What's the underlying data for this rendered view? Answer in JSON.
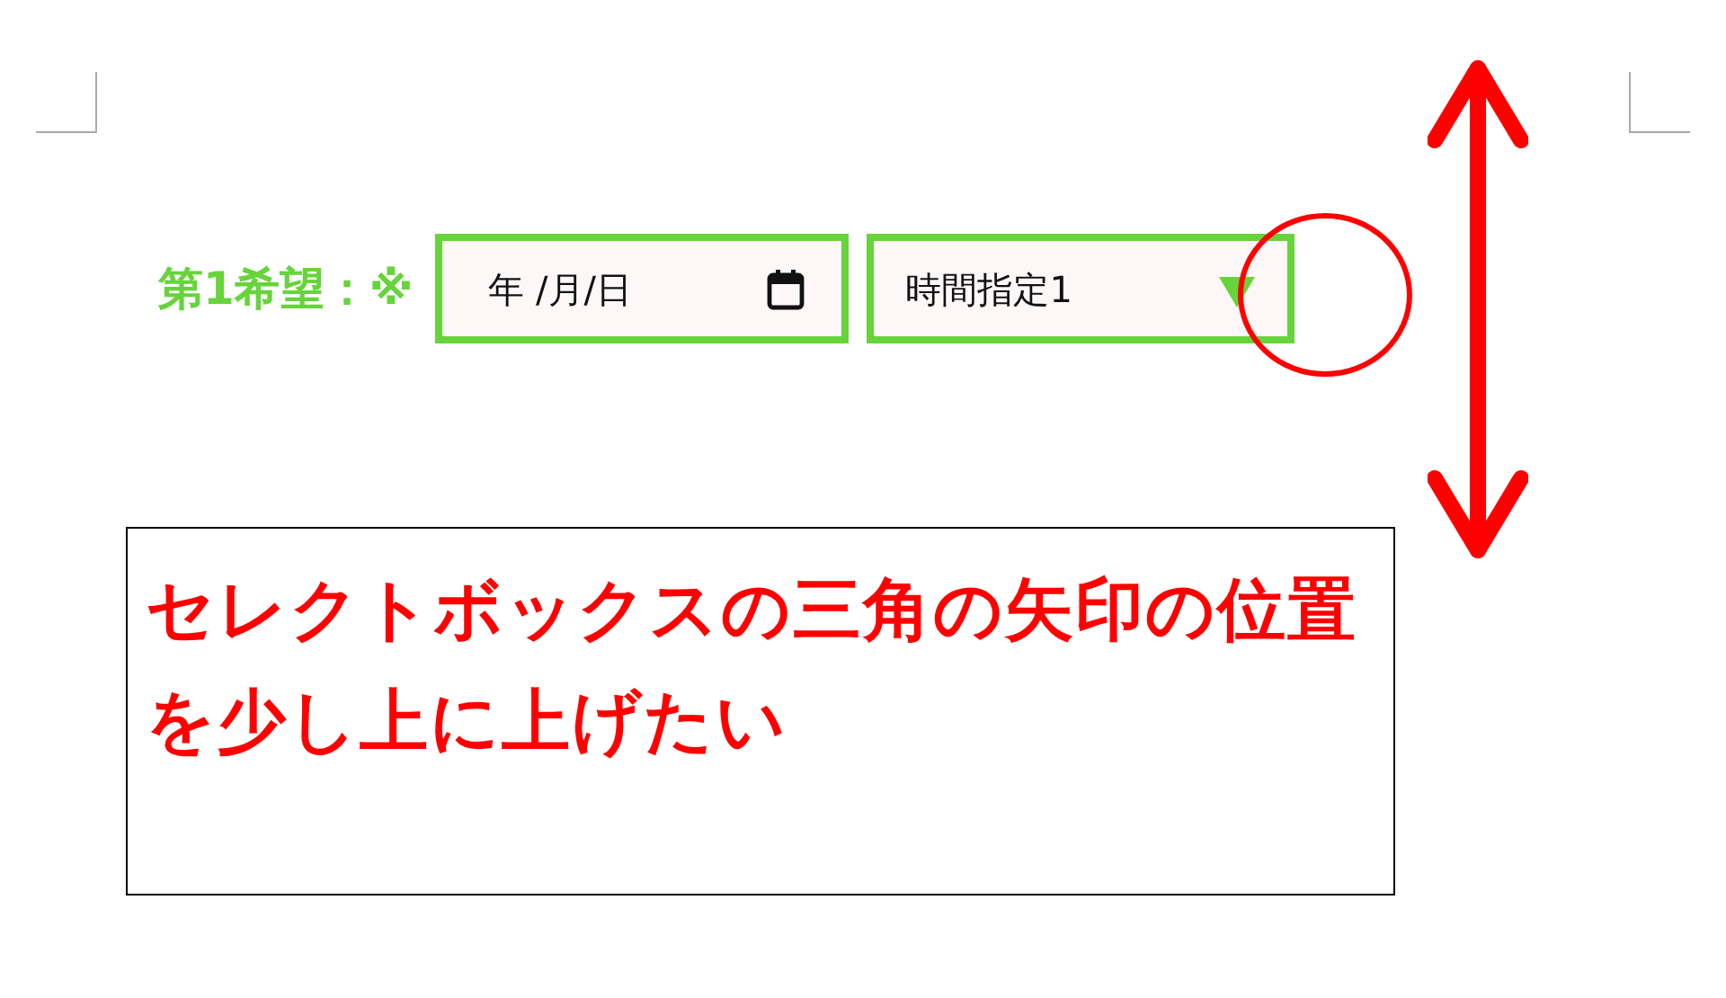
{
  "form_row": {
    "label": "第1希望：※",
    "date_field": {
      "value": "年 /月/日"
    },
    "time_select": {
      "value": "時間指定1"
    }
  },
  "note": {
    "text": "セレクトボックスの三角の矢印の位置を少し上に上げたい"
  }
}
